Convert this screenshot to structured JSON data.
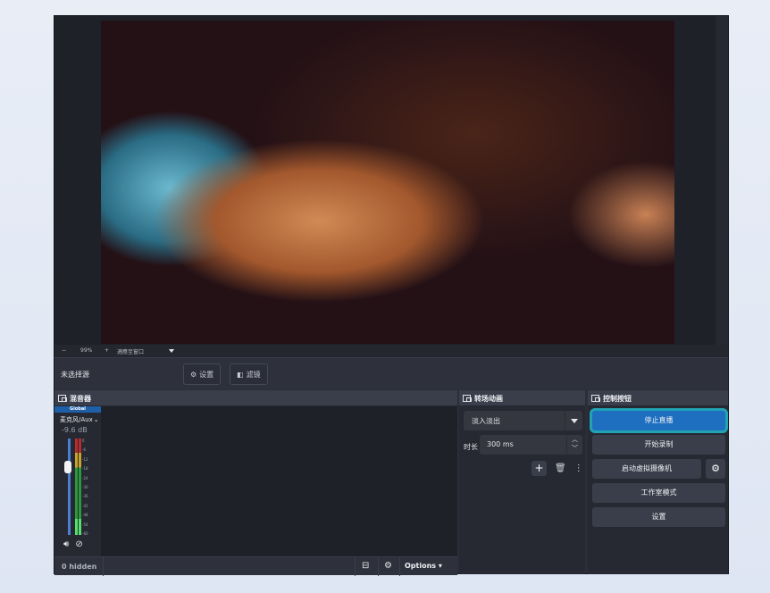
{
  "zoom": {
    "minus": "−",
    "percent": "99%",
    "plus": "+",
    "fit_label": "適應至窗口"
  },
  "source": {
    "none_selected": "未选择源",
    "settings_label": "设置",
    "filters_label": "滤镜"
  },
  "mixer": {
    "title": "混音器",
    "global_tag": "Global",
    "channel_name": "麦克风/Aux",
    "volume_db": "-9.6 dB",
    "fader_level": 0.7,
    "meter_level": 0.17,
    "scale": [
      "0",
      "-6",
      "-12",
      "-18",
      "-24",
      "-30",
      "-36",
      "-42",
      "-48",
      "-54",
      "-60"
    ],
    "hidden_count": "0 hidden",
    "options_label": "Options"
  },
  "transitions": {
    "title": "转场动画",
    "selected": "淡入淡出",
    "duration_label": "时长",
    "duration_value": "300 ms"
  },
  "controls": {
    "title": "控制按钮",
    "stop_stream": "停止直播",
    "start_record": "开始录制",
    "virtual_cam": "启动虚拟摄像机",
    "studio_mode": "工作室模式",
    "settings": "设置"
  },
  "colors": {
    "accent": "#1e6fc0",
    "focus_ring": "#21a3b4",
    "panel_bg": "#262932"
  },
  "icons": [
    "gear-icon",
    "filter-icon",
    "speaker-icon",
    "mute-settings-icon",
    "layout-icon",
    "advanced-gear-icon",
    "plus-icon",
    "trash-icon",
    "more-icon"
  ]
}
